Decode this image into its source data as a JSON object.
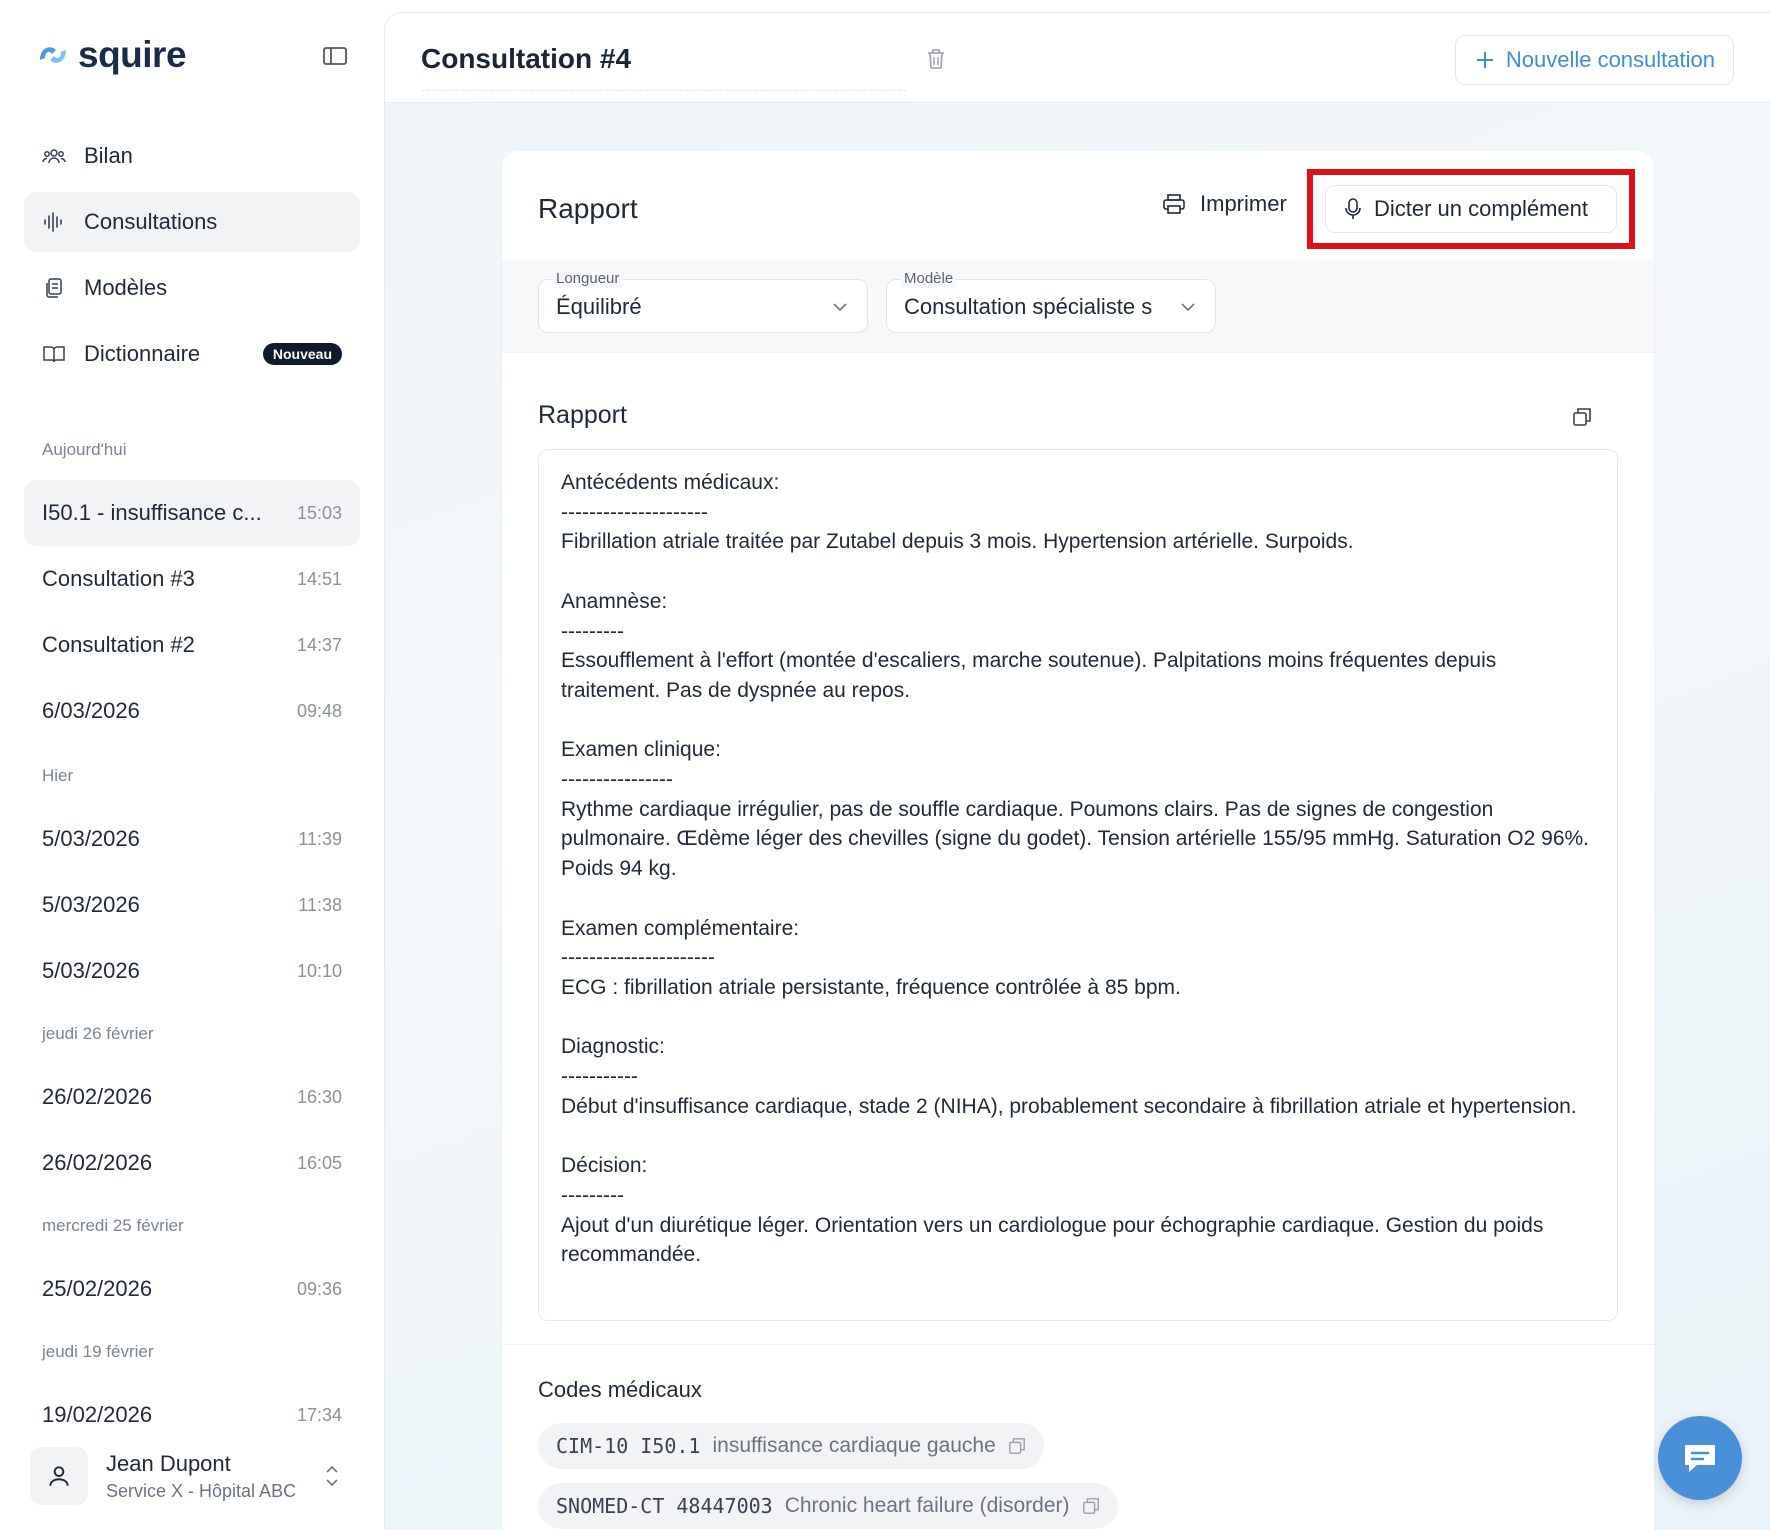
{
  "app": {
    "name": "squire"
  },
  "nav": [
    {
      "label": "Bilan",
      "icon": "users-icon"
    },
    {
      "label": "Consultations",
      "icon": "waveform-icon",
      "active": true
    },
    {
      "label": "Modèles",
      "icon": "copy-doc-icon"
    },
    {
      "label": "Dictionnaire",
      "icon": "book-icon",
      "badge": "Nouveau"
    }
  ],
  "history": {
    "today": {
      "label": "Aujourd'hui",
      "items": [
        {
          "title": "I50.1 - insuffisance c...",
          "time": "15:03",
          "active": true
        },
        {
          "title": "Consultation #3",
          "time": "14:51"
        },
        {
          "title": "Consultation #2",
          "time": "14:37"
        },
        {
          "title": "6/03/2026",
          "time": "09:48"
        }
      ]
    },
    "yesterday": {
      "label": "Hier",
      "items": [
        {
          "title": "5/03/2026",
          "time": "11:39"
        },
        {
          "title": "5/03/2026",
          "time": "11:38"
        },
        {
          "title": "5/03/2026",
          "time": "10:10"
        }
      ]
    },
    "feb26": {
      "label": "jeudi 26 février",
      "items": [
        {
          "title": "26/02/2026",
          "time": "16:30"
        },
        {
          "title": "26/02/2026",
          "time": "16:05"
        }
      ]
    },
    "feb25": {
      "label": "mercredi 25 février",
      "items": [
        {
          "title": "25/02/2026",
          "time": "09:36"
        }
      ]
    },
    "feb19": {
      "label": "jeudi 19 février",
      "items": [
        {
          "title": "19/02/2026",
          "time": "17:34"
        }
      ]
    }
  },
  "user": {
    "name": "Jean Dupont",
    "service": "Service X - Hôpital ABC"
  },
  "header": {
    "title": "Consultation #4",
    "new_button": "Nouvelle consultation"
  },
  "card": {
    "title": "Rapport",
    "print_label": "Imprimer",
    "dictate_label": "Dicter un complément",
    "longueur": {
      "label": "Longueur",
      "value": "Équilibré"
    },
    "modele": {
      "label": "Modèle",
      "value": "Consultation spécialiste s"
    },
    "report_title": "Rapport",
    "report_lines": [
      "Antécédents médicaux:",
      "---------------------",
      "Fibrillation atriale traitée par Zutabel depuis 3 mois. Hypertension artérielle. Surpoids.",
      "",
      "Anamnèse:",
      "---------",
      "Essoufflement à l'effort (montée d'escaliers, marche soutenue). Palpitations moins fréquentes depuis traitement. Pas de dyspnée au repos.",
      "",
      "Examen clinique:",
      "----------------",
      "Rythme cardiaque irrégulier, pas de souffle cardiaque. Poumons clairs. Pas de signes de congestion pulmonaire. Œdème léger des chevilles (signe du godet). Tension artérielle 155/95 mmHg. Saturation O2 96%. Poids 94 kg.",
      "",
      "Examen complémentaire:",
      "----------------------",
      "ECG : fibrillation atriale persistante, fréquence contrôlée à 85 bpm.",
      "",
      "Diagnostic:",
      "-----------",
      "Début d'insuffisance cardiaque, stade 2 (NIHA), probablement secondaire à fibrillation atriale et hypertension.",
      "",
      "Décision:",
      "---------",
      "Ajout d'un diurétique léger. Orientation vers un cardiologue pour échographie cardiaque. Gestion du poids recommandée."
    ],
    "codes_title": "Codes médicaux",
    "codes": [
      {
        "system": "CIM-10",
        "code": "I50.1",
        "description": "insuffisance cardiaque gauche"
      },
      {
        "system": "SNOMED-CT",
        "code": "48447003",
        "description": "Chronic heart failure (disorder)"
      }
    ]
  },
  "colors": {
    "accent": "#3f8ed1",
    "highlight": "#e0101a",
    "fab": "#4a90d9"
  }
}
